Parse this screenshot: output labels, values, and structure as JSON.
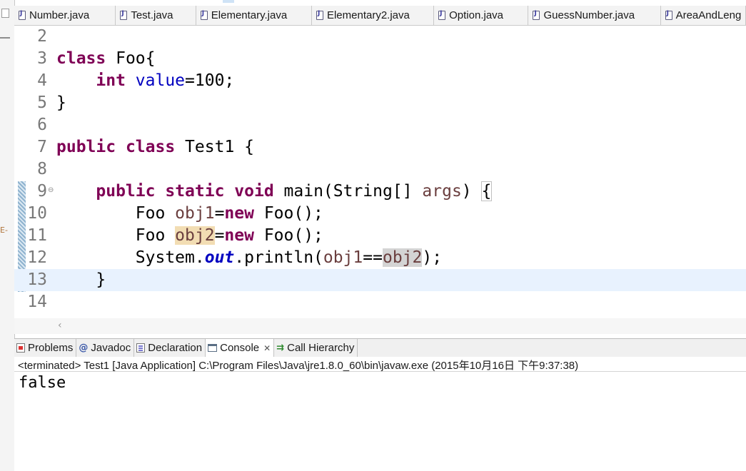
{
  "editor_tabs": [
    {
      "label": "Number.java",
      "icon": "java-file-icon"
    },
    {
      "label": "Test.java",
      "icon": "java-file-icon"
    },
    {
      "label": "Elementary.java",
      "icon": "java-file-icon"
    },
    {
      "label": "Elementary2.java",
      "icon": "java-file-icon"
    },
    {
      "label": "Option.java",
      "icon": "java-file-icon"
    },
    {
      "label": "GuessNumber.java",
      "icon": "java-file-icon"
    },
    {
      "label": "AreaAndLeng",
      "icon": "java-file-icon"
    }
  ],
  "line_numbers": [
    "2",
    "3",
    "4",
    "5",
    "6",
    "7",
    "8",
    "9",
    "10",
    "11",
    "12",
    "13",
    "14"
  ],
  "code": {
    "l3_kw": "class",
    "l3_rest": " Foo{",
    "l4_indent": "    ",
    "l4_kw": "int",
    "l4_sp": " ",
    "l4_field": "value",
    "l4_rest": "=100;",
    "l5": "}",
    "l7_kw1": "public",
    "l7_sp": " ",
    "l7_kw2": "class",
    "l7_rest": " Test1 {",
    "l9_indent": "    ",
    "l9_kw1": "public",
    "l9_kw2": "static",
    "l9_kw3": "void",
    "l9_mid": " main(String[] ",
    "l9_param": "args",
    "l9_close": ") ",
    "l9_brace": "{",
    "l10_indent": "        ",
    "l10_type": "Foo ",
    "l10_var": "obj1",
    "l10_eq": "=",
    "l10_kw": "new",
    "l10_rest": " Foo();",
    "l11_indent": "        ",
    "l11_type": "Foo ",
    "l11_var": "obj2",
    "l11_eq": "=",
    "l11_kw": "new",
    "l11_rest": " Foo();",
    "l12_indent": "        ",
    "l12_sys": "System.",
    "l12_out": "out",
    "l12_mid": ".println(",
    "l12_a": "obj1",
    "l12_op": "==",
    "l12_b": "obj2",
    "l12_end": ");",
    "l13": "    }"
  },
  "fold_marker": "⊖",
  "panel_tabs": [
    {
      "label": "Problems",
      "icon": "problems-icon"
    },
    {
      "label": "Javadoc",
      "icon": "javadoc-icon"
    },
    {
      "label": "Declaration",
      "icon": "declaration-icon"
    },
    {
      "label": "Console",
      "icon": "console-icon",
      "active": true,
      "close": "✕"
    },
    {
      "label": "Call Hierarchy",
      "icon": "call-hierarchy-icon"
    }
  ],
  "console": {
    "status": "<terminated> Test1 [Java Application] C:\\Program Files\\Java\\jre1.8.0_60\\bin\\javaw.exe (2015年10月16日 下午9:37:38)",
    "output": "false"
  },
  "left_strip_marker": "E-",
  "scroll_arrow": "‹",
  "colors": {
    "keyword": "#7f0055",
    "field": "#0000c0",
    "local": "#6a3e3e",
    "current_line": "#e8f2fe",
    "write_occurrence": "#f2ddb3",
    "read_occurrence": "#d4d4d4"
  }
}
